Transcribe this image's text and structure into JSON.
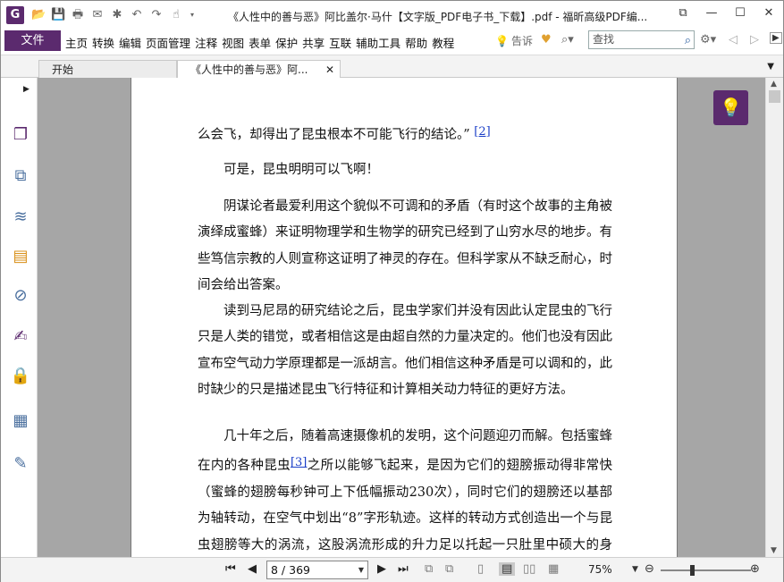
{
  "titlebar": {
    "app_icon_letter": "G",
    "title": "《人性中的善与恶》阿比盖尔·马什【文字版_PDF电子书_下载】.pdf - 福昕高级PDF编...",
    "quick_access": [
      "open-icon",
      "save-icon",
      "print-icon",
      "email-icon",
      "new-icon",
      "undo-icon",
      "redo-icon",
      "hand-tool-icon"
    ],
    "window_controls": {
      "restore_small": "⧉",
      "minimize": "—",
      "maximize": "☐",
      "close": "✕"
    }
  },
  "menubar": {
    "file": "文件",
    "items": [
      "主页",
      "转换",
      "编辑",
      "页面管理",
      "注释",
      "视图",
      "表单",
      "保护",
      "共享",
      "互联",
      "辅助工具",
      "帮助",
      "教程"
    ],
    "tell_me": "告诉",
    "search_placeholder": "查找"
  },
  "tabs": [
    {
      "label": "开始",
      "active": false
    },
    {
      "label": "《人性中的善与恶》阿...",
      "active": true,
      "close": "✕"
    }
  ],
  "left_panel": {
    "icons": [
      "page-thumbnails-icon",
      "pages-icon",
      "layers-icon",
      "comments-icon",
      "attachments-icon",
      "signatures-icon",
      "security-icon",
      "form-fields-icon",
      "edit-tools-icon"
    ]
  },
  "document": {
    "paragraphs": [
      {
        "text": "么会飞，却得出了昆虫根本不可能飞行的结论。”",
        "footnote": "[2]",
        "indent": false
      },
      {
        "text": "可是，昆虫明明可以飞啊！",
        "indent": true
      },
      {
        "text": "阴谋论者最爱利用这个貌似不可调和的矛盾（有时这个故事的主角被演绎成蜜蜂）来证明物理学和生物学的研究已经到了山穷水尽的地步。有些笃信宗教的人则宣称这证明了神灵的存在。但科学家从不缺乏耐心，时间会给出答案。",
        "indent": true
      },
      {
        "text": "读到马尼昂的研究结论之后，昆虫学家们并没有因此认定昆虫的飞行只是人类的错觉，或者相信这是由超自然的力量决定的。他们也没有因此宣布空气动力学原理都是一派胡言。他们相信这种矛盾是可以调和的，此时缺少的只是描述昆虫飞行特征和计算相关动力特征的更好方法。",
        "indent": true
      },
      {
        "text_before": "几十年之后，随着高速摄像机的发明，这个问题迎刃而解。包括蜜蜂在内的各种昆虫",
        "footnote": "[3]",
        "text_after": "之所以能够飞起来，是因为它们的翅膀振动得非常快（蜜蜂的翅膀每秒钟可上下低幅振动230次），同时它们的翅膀还以基部为轴转动，在空气中划出“8”字形轨迹。这样的转动方式创造出一个与昆虫翅膀等大的涡流，这股涡流形成的升力足以托起一只肚里中硕大的身躯。",
        "indent": true
      }
    ]
  },
  "statusbar": {
    "page_display": "8 / 369",
    "zoom": "75%",
    "zoom_fraction": 0.33
  }
}
